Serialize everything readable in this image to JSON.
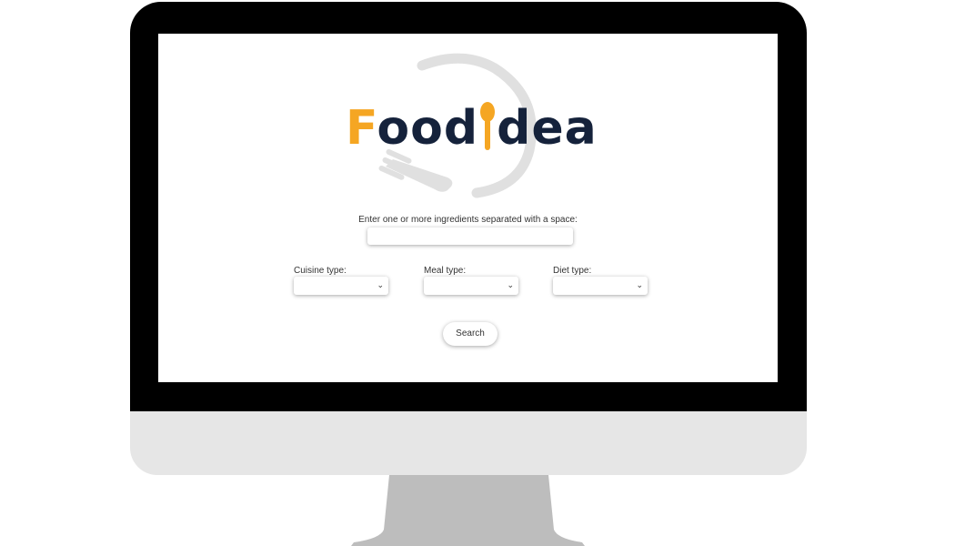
{
  "app": {
    "logo_left": "Food",
    "logo_right": "dea",
    "colors": {
      "logo_accent": "#f5a623",
      "logo_text": "#15223b",
      "bezel": "#000000",
      "chin": "#e6e6e6",
      "stand": "#bdbdbd"
    }
  },
  "form": {
    "ingredients_label": "Enter one or more ingredients separated with a space:",
    "ingredients_value": "",
    "cuisine_label": "Cuisine type:",
    "cuisine_value": "",
    "meal_label": "Meal type:",
    "meal_value": "",
    "diet_label": "Diet type:",
    "diet_value": "",
    "search_label": "Search"
  },
  "icons": {
    "dropdown": "chevron-down-icon",
    "logo_spoon": "spoon-icon",
    "logo_plate": "plate-fork-icon"
  }
}
